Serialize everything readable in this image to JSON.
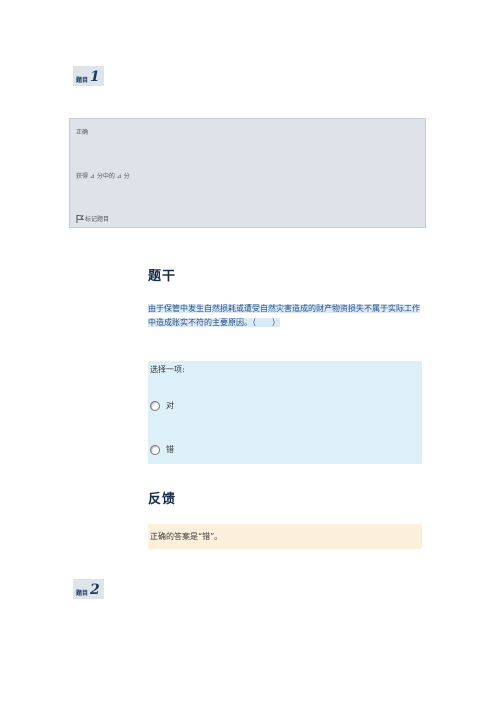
{
  "q1": {
    "label": "题目",
    "number": "1"
  },
  "info": {
    "state": "正确",
    "grade": "获得 ⊿ 分中的 ⊿ 分",
    "flag": "标记题目"
  },
  "stem": {
    "title": "题干",
    "text": "由于保管中发生自然损耗或遭受自然灾害造成的财产物资损失不属于实际工作中造成账实不符的主要原因。（　　）"
  },
  "answer": {
    "prompt": "选择一项:",
    "options": [
      {
        "label": "对",
        "selected": false
      },
      {
        "label": "错",
        "selected": false
      }
    ]
  },
  "feedback": {
    "title": "反馈",
    "text": "正确的答案是“错”。"
  },
  "q2": {
    "label": "题目",
    "number": "2"
  }
}
